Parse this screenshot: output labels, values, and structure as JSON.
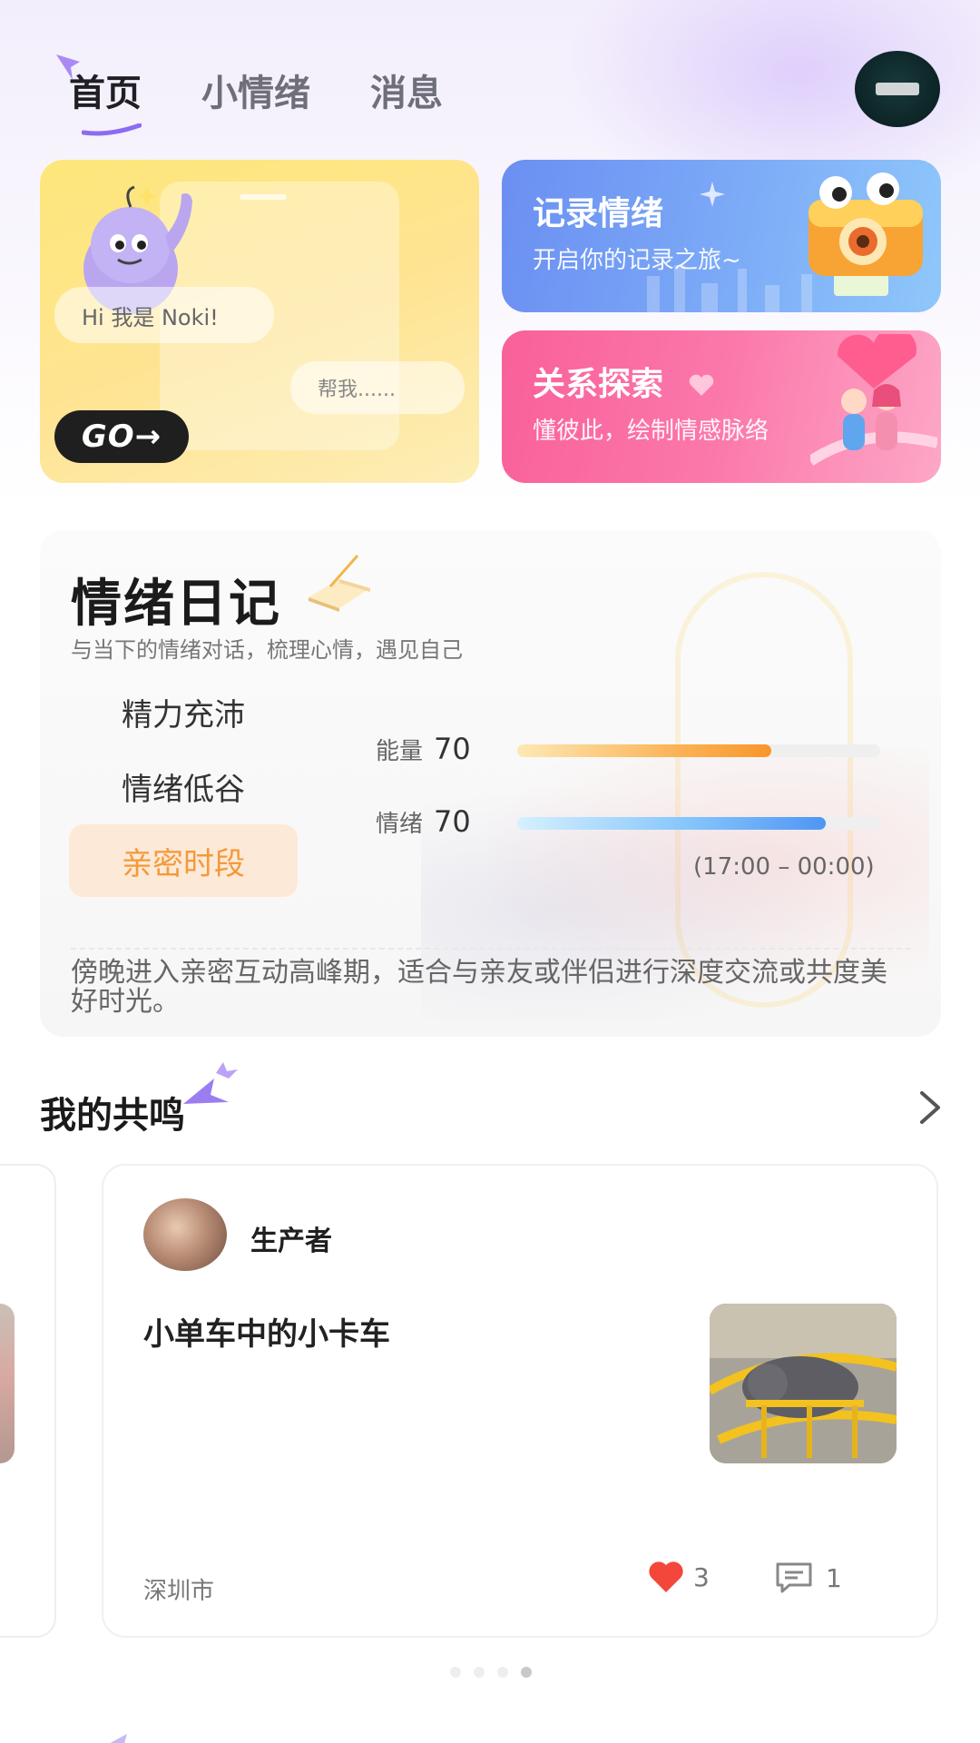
{
  "header": {
    "tabs": [
      {
        "label": "首页",
        "active": true
      },
      {
        "label": "小情绪",
        "active": false
      },
      {
        "label": "消息",
        "active": false
      }
    ],
    "accent_color": "#8b6cf0"
  },
  "noki_card": {
    "greeting": "Hi 我是 Noki!",
    "prompt": "帮我......",
    "go_label": "GO→"
  },
  "record_card": {
    "title": "记录情绪",
    "subtitle": "开启你的记录之旅~",
    "icon": "camera-icon"
  },
  "relation_card": {
    "title": "关系探索",
    "subtitle": "懂彼此，绘制情感脉络",
    "icon": "couple-icon"
  },
  "diary": {
    "title": "情绪日记",
    "subtitle": "与当下的情绪对话，梳理心情，遇见自己",
    "moods": [
      {
        "label": "精力充沛",
        "active": false
      },
      {
        "label": "情绪低谷",
        "active": false
      },
      {
        "label": "亲密时段",
        "active": true
      }
    ],
    "energy": {
      "label": "能量",
      "value": "70",
      "fill_fraction": 0.7
    },
    "mood": {
      "label": "情绪",
      "value": "70",
      "fill_fraction": 0.85
    },
    "time_range": "(17:00 – 00:00)",
    "description": "傍晚进入亲密互动高峰期，适合与亲友或伴侣进行深度交流或共度美好时光。"
  },
  "resonance": {
    "title": "我的共鸣",
    "post": {
      "author": "生产者",
      "text": "小单车中的小卡车",
      "location": "深圳市",
      "likes": "3",
      "comments": "1"
    },
    "pager": {
      "count": 4,
      "active_index": 3
    }
  }
}
